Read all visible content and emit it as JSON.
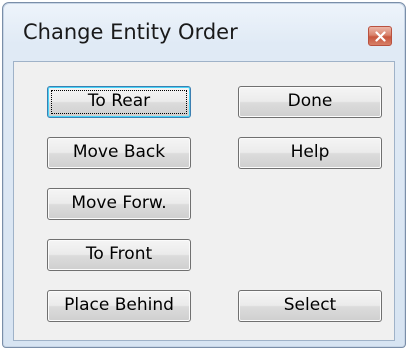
{
  "window": {
    "title": "Change Entity Order"
  },
  "buttons": {
    "to_rear": "To Rear",
    "move_back": "Move Back",
    "move_forward": "Move Forw.",
    "to_front": "To Front",
    "place_behind": "Place Behind",
    "done": "Done",
    "help": "Help",
    "select": "Select"
  },
  "icons": {
    "close": "close-icon"
  },
  "colors": {
    "close_button": "#c8563d",
    "focus_highlight": "#48d4f8"
  }
}
